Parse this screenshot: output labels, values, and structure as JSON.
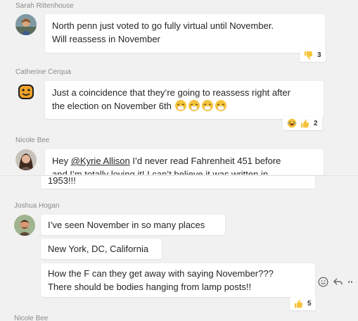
{
  "messages": [
    {
      "author": "Sarah Rittenhouse",
      "lines": [
        "North penn just voted to go fully virtual until November.",
        "Will reassess in November"
      ],
      "reaction": {
        "icon": "thumbs-down-icon",
        "count": "3"
      }
    },
    {
      "author": "Catherine Cerqua",
      "lines": [
        "Just a coincidence that they’re going to reassess right after",
        "the election on November 6th"
      ],
      "reaction": {
        "icons": [
          "laughing-emoji-icon",
          "thumbs-up-icon"
        ],
        "count": "2"
      }
    },
    {
      "author": "Nicole Bee",
      "line1_prefix": "Hey ",
      "mention": "@Kyrie Allison",
      "line1_suffix": " I’d never read Fahrenheit 451 before",
      "line2": "and I’m totally loving it! I can’t believe it was written in",
      "continued": "1953!!!"
    },
    {
      "author": "Joshua Hogan",
      "bubbles": [
        {
          "lines": [
            "I’ve seen November in so many places"
          ]
        },
        {
          "lines": [
            "New York, DC, California"
          ]
        },
        {
          "lines": [
            "How the F can they get away with saying November???",
            "There should be bodies hanging from lamp posts!!"
          ]
        }
      ],
      "reaction": {
        "icon": "thumbs-up-icon",
        "count": "5"
      }
    },
    {
      "author": "Nicole Bee"
    }
  ],
  "colors": {
    "background": "#f1f1f1",
    "bubble": "#ffffff",
    "author_text": "#8a8a8a",
    "emoji_yellow": "#f6c33b",
    "mention_accent": "#252525"
  }
}
